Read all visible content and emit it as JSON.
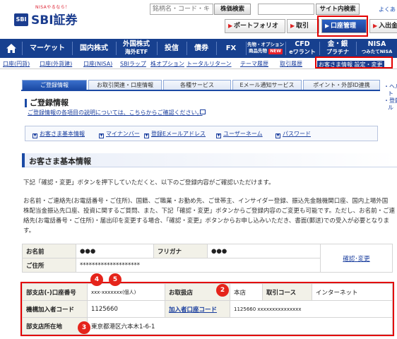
{
  "header": {
    "logo": {
      "tagline": "NISAやるなら！",
      "mark": "SBI",
      "name": "SBI証券"
    },
    "search_placeholder": "銘柄名・コード・キーワ",
    "stock_search_label": "株価検索",
    "site_search_label": "サイト内検索",
    "faq_label": "よくあ",
    "buttons": {
      "portfolio": "ポートフォリオ",
      "transaction": "取引",
      "account": "口座管理",
      "deposit": "入出金"
    }
  },
  "main_nav": {
    "market": "マーケット",
    "domestic_stocks": "国内株式",
    "foreign_stocks": [
      "外国株式",
      "海外ETF"
    ],
    "investment_trust": "投信",
    "bonds": "債券",
    "fx": "FX",
    "futures": [
      "先物・オプション",
      "商品先物"
    ],
    "futures_badge": "NEW",
    "cfd": [
      "CFD",
      "eワラント"
    ],
    "gold": [
      "金・銀",
      "プラチナ"
    ],
    "nisa": [
      "NISA",
      "つみたてNISA"
    ]
  },
  "sub_nav": [
    "口座(円貨)",
    "口座(外貨建)",
    "口座(NISA)",
    "SBIラップ",
    "株オプション",
    "トータルリターン",
    "テーマ履歴",
    "取引履歴",
    "お客さま情報 設定・変更"
  ],
  "tabs": [
    "ご登録情報",
    "お取引関連・口座情報",
    "各種サービス",
    "Eメール通知サービス",
    "ポイント・外部ID連携"
  ],
  "side_menu": [
    "・ヘル",
    "ト",
    "・登録",
    "ル"
  ],
  "registration": {
    "title": "ご登録情報",
    "description": "ご登録情報の各項目の説明については、こちらからご確認ください。"
  },
  "anchors": [
    "お客さま基本情報",
    "マイナンバー",
    "登録Eメールアドレス",
    "ユーザーネーム",
    "パスワード"
  ],
  "basic": {
    "title": "お客さま基本情報",
    "paragraphs": [
      "下記「確認・変更」ボタンを押下していただくと、以下のご登録内容がご確認いただけます。",
      "お名前・ご連絡先(お電話番号・ご住所)、国籍、ご職業・お勤め先、ご世帯主、インサイダー登録、振込先金融機関口座、国内上場外国",
      "株配当金振込先口座、投資に関するご質問、また、下記「確認・変更」ボタンからご登録内容のご変更も可能です。ただし、お名前・ご連",
      "絡先(お電話番号・ご住所)・届出印を変更する場合、「確認・変更」ボタンからお申し込みいただき、書面(郵送)での受入が必要となりま",
      "す。"
    ]
  },
  "name_table": {
    "name_label": "お名前",
    "name_value": "●●●",
    "kana_label": "フリガナ",
    "kana_value": "●●●",
    "address_label": "ご住所",
    "address_value": "********************",
    "confirm_link": "確認･変更"
  },
  "detail_table": {
    "branch_account_label": "部支店(-)口座番号",
    "branch_account_value": "xxx-xxxxxxx(個人)",
    "handling_branch_label": "お取扱店",
    "handling_branch_value": "本店",
    "course_label": "取引コース",
    "course_value": "インターネット",
    "institution_code_label": "機構加入者コード",
    "institution_code_value": "1125660",
    "subscriber_account_label": "加入者口座コード",
    "subscriber_account_value": "1125660 xxxxxxxxxxxxxxx",
    "branch_address_label": "部支店所在地",
    "branch_address_value": "東京都港区六本木1-6-1"
  },
  "markers": [
    "2",
    "3",
    "4",
    "5"
  ],
  "colors": {
    "brand_blue": "#17408f",
    "highlight_red": "#e30000",
    "marker_red": "#e5241b",
    "label_bg": "#f2f1e8"
  }
}
